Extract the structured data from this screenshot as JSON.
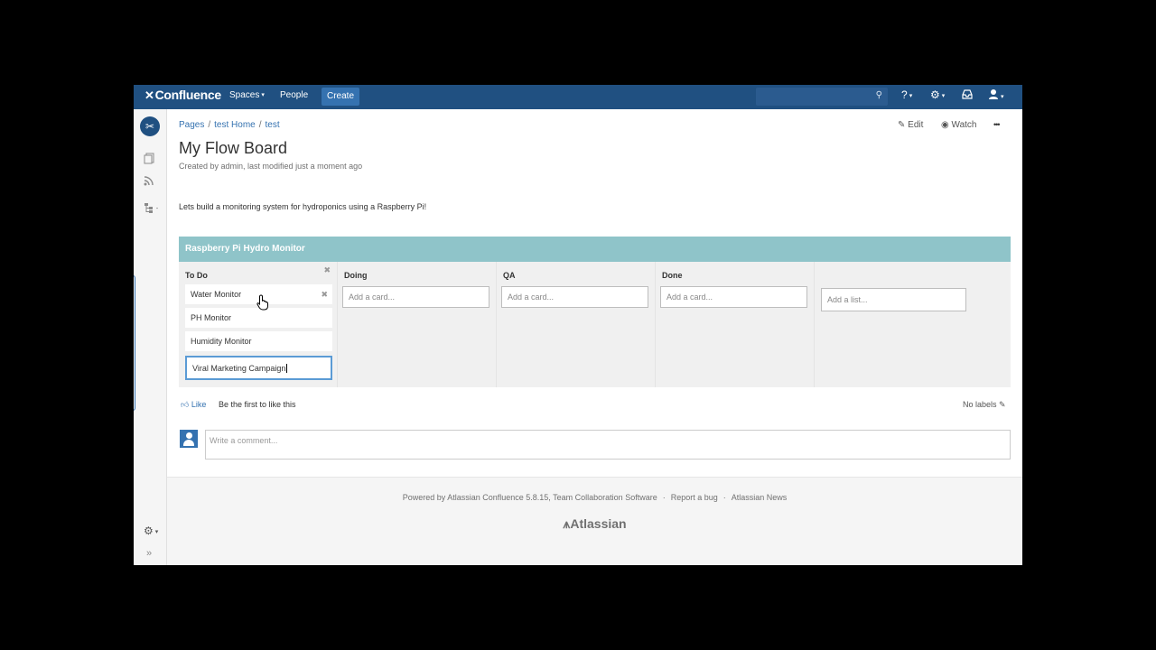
{
  "nav": {
    "logo_mark": "✕",
    "logo": "Confluence",
    "spaces": "Spaces",
    "people": "People",
    "create": "Create"
  },
  "breadcrumb": {
    "pages": "Pages",
    "home": "test Home",
    "current": "test"
  },
  "actions": {
    "edit": "Edit",
    "watch": "Watch",
    "more": "•••"
  },
  "page": {
    "title": "My Flow Board",
    "meta": "Created by admin, last modified just a moment ago",
    "body": "Lets build a monitoring system for hydroponics using a Raspberry Pi!"
  },
  "board": {
    "title": "Raspberry Pi Hydro Monitor",
    "lists": [
      {
        "title": "To Do",
        "cards": [
          "Water Monitor",
          "PH Monitor",
          "Humidity Monitor"
        ],
        "editing": "Viral Marketing Campaign"
      },
      {
        "title": "Doing",
        "add": "Add a card..."
      },
      {
        "title": "QA",
        "add": "Add a card..."
      },
      {
        "title": "Done",
        "add": "Add a card..."
      }
    ],
    "add_list": "Add a list..."
  },
  "likes": {
    "like": "Like",
    "text": "Be the first to like this",
    "labels": "No labels"
  },
  "comment": {
    "placeholder": "Write a comment..."
  },
  "footer": {
    "powered": "Powered by Atlassian Confluence 5.8.15, Team Collaboration Software",
    "report": "Report a bug",
    "news": "Atlassian News",
    "logo": "Atlassian"
  }
}
